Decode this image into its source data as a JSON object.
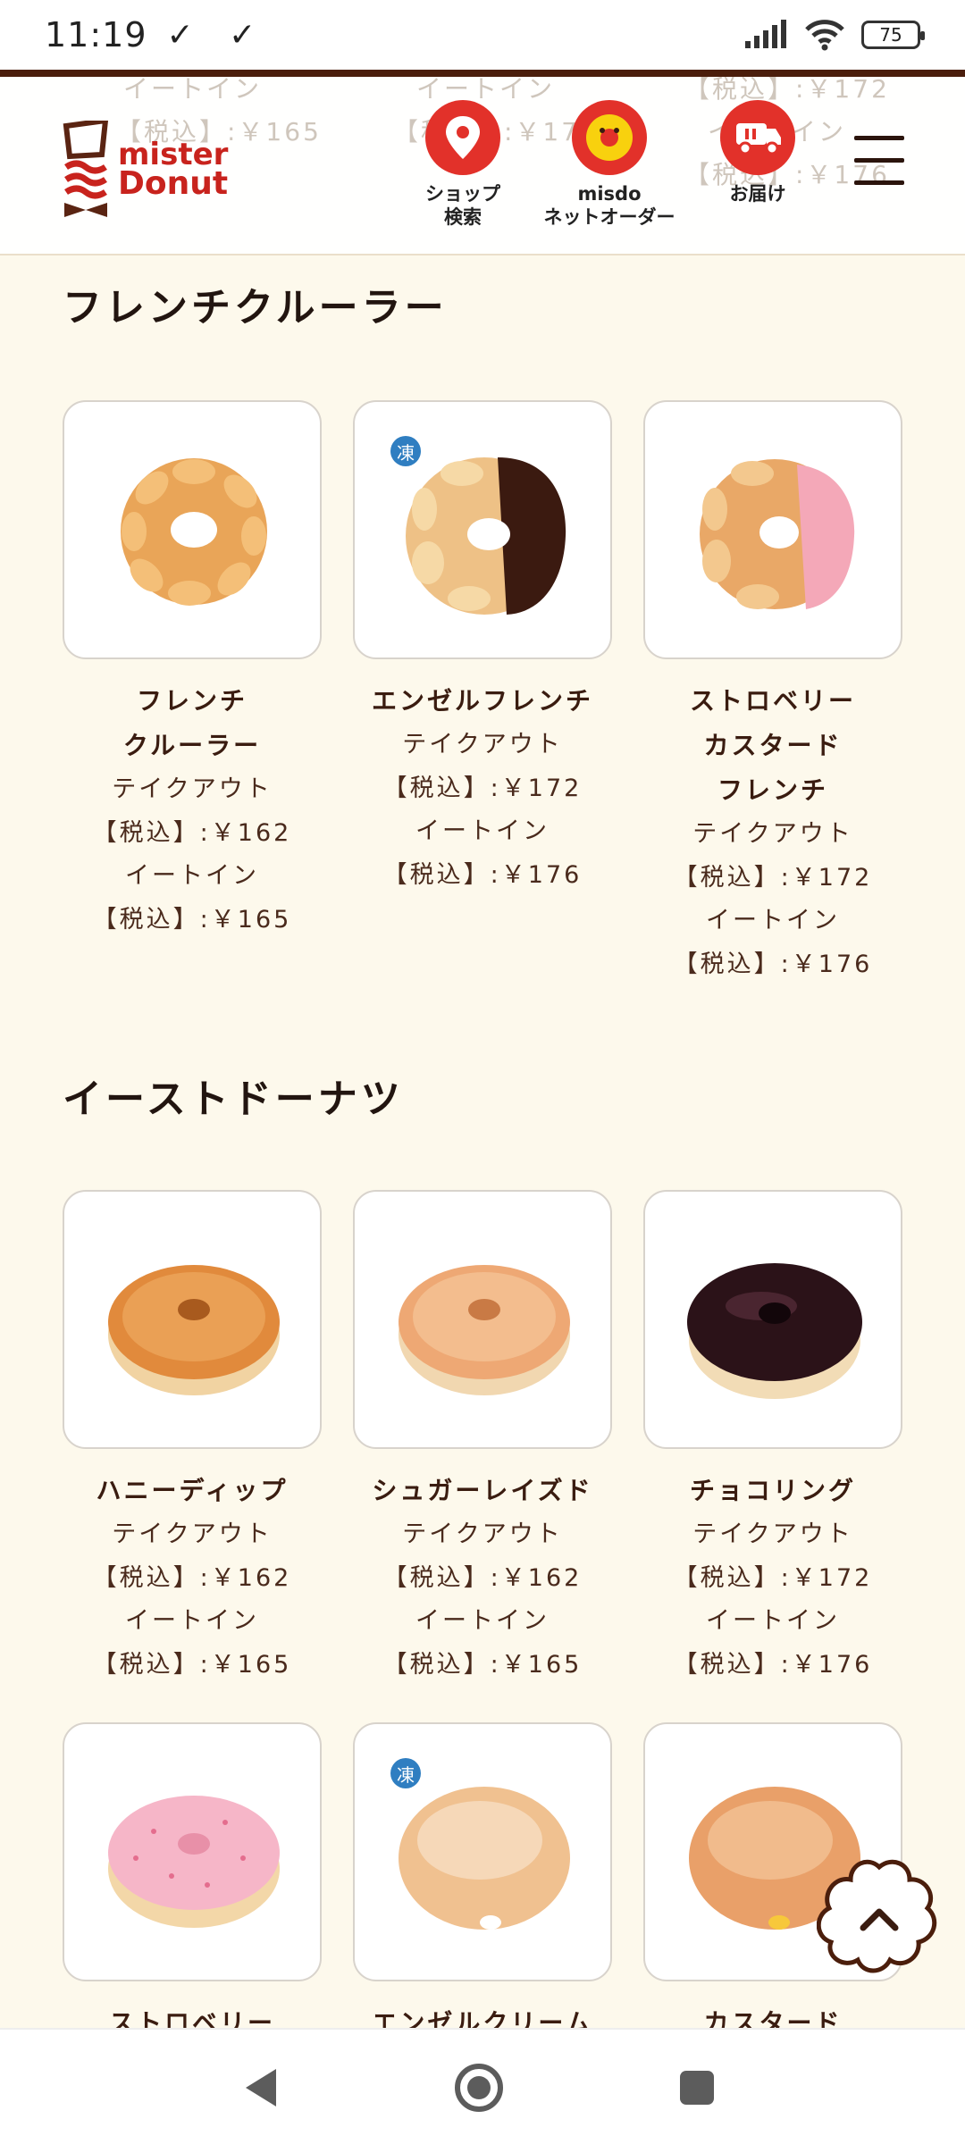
{
  "status_bar": {
    "time": "11:19",
    "notifications": "✓ ✓",
    "battery": "75"
  },
  "header": {
    "ghost_texts": [
      "イートイン",
      "【税込】:￥165",
      "イートイン",
      "【税込】:￥176",
      "【税込】:￥172",
      "イートイン",
      "【税込】:￥176"
    ],
    "logo": {
      "line1": "mister",
      "line2": "Donut",
      "color": "#c8231d"
    },
    "nav": [
      {
        "icon": "map-pin-icon",
        "label": "ショップ\n検索"
      },
      {
        "icon": "misdo-character-icon",
        "label": "misdo\nネットオーダー"
      },
      {
        "icon": "delivery-truck-icon",
        "label": "お届け"
      }
    ],
    "menu_icon": "hamburger-menu-icon"
  },
  "sections": [
    {
      "title": "フレンチクルーラー",
      "products": [
        {
          "name": "フレンチ\nクルーラー",
          "frozen": false,
          "info": "テイクアウト\n【税込】:￥162\nイートイン\n【税込】:￥165"
        },
        {
          "name": "エンゼルフレンチ",
          "frozen": true,
          "frozen_mark": "凍",
          "info": "テイクアウト\n【税込】:￥172\nイートイン\n【税込】:￥176"
        },
        {
          "name": "ストロベリー\nカスタード\nフレンチ",
          "frozen": false,
          "info": "テイクアウト\n【税込】:￥172\nイートイン\n【税込】:￥176"
        }
      ]
    },
    {
      "title": "イーストドーナツ",
      "products": [
        {
          "name": "ハニーディップ",
          "frozen": false,
          "info": "テイクアウト\n【税込】:￥162\nイートイン\n【税込】:￥165"
        },
        {
          "name": "シュガーレイズド",
          "frozen": false,
          "info": "テイクアウト\n【税込】:￥162\nイートイン\n【税込】:￥165"
        },
        {
          "name": "チョコリング",
          "frozen": false,
          "info": "テイクアウト\n【税込】:￥172\nイートイン\n【税込】:￥176"
        },
        {
          "name": "ストロベリー",
          "frozen": false,
          "info": ""
        },
        {
          "name": "エンゼルクリーム",
          "frozen": true,
          "frozen_mark": "凍",
          "info": ""
        },
        {
          "name": "カスタード",
          "frozen": false,
          "info": ""
        }
      ]
    }
  ],
  "scroll_top_icon": "chevron-up-icon",
  "colors": {
    "brand_red": "#e2312a",
    "brown": "#4b1e0c",
    "background": "#fdf9ec",
    "frozen_blue": "#2f7ec1"
  }
}
